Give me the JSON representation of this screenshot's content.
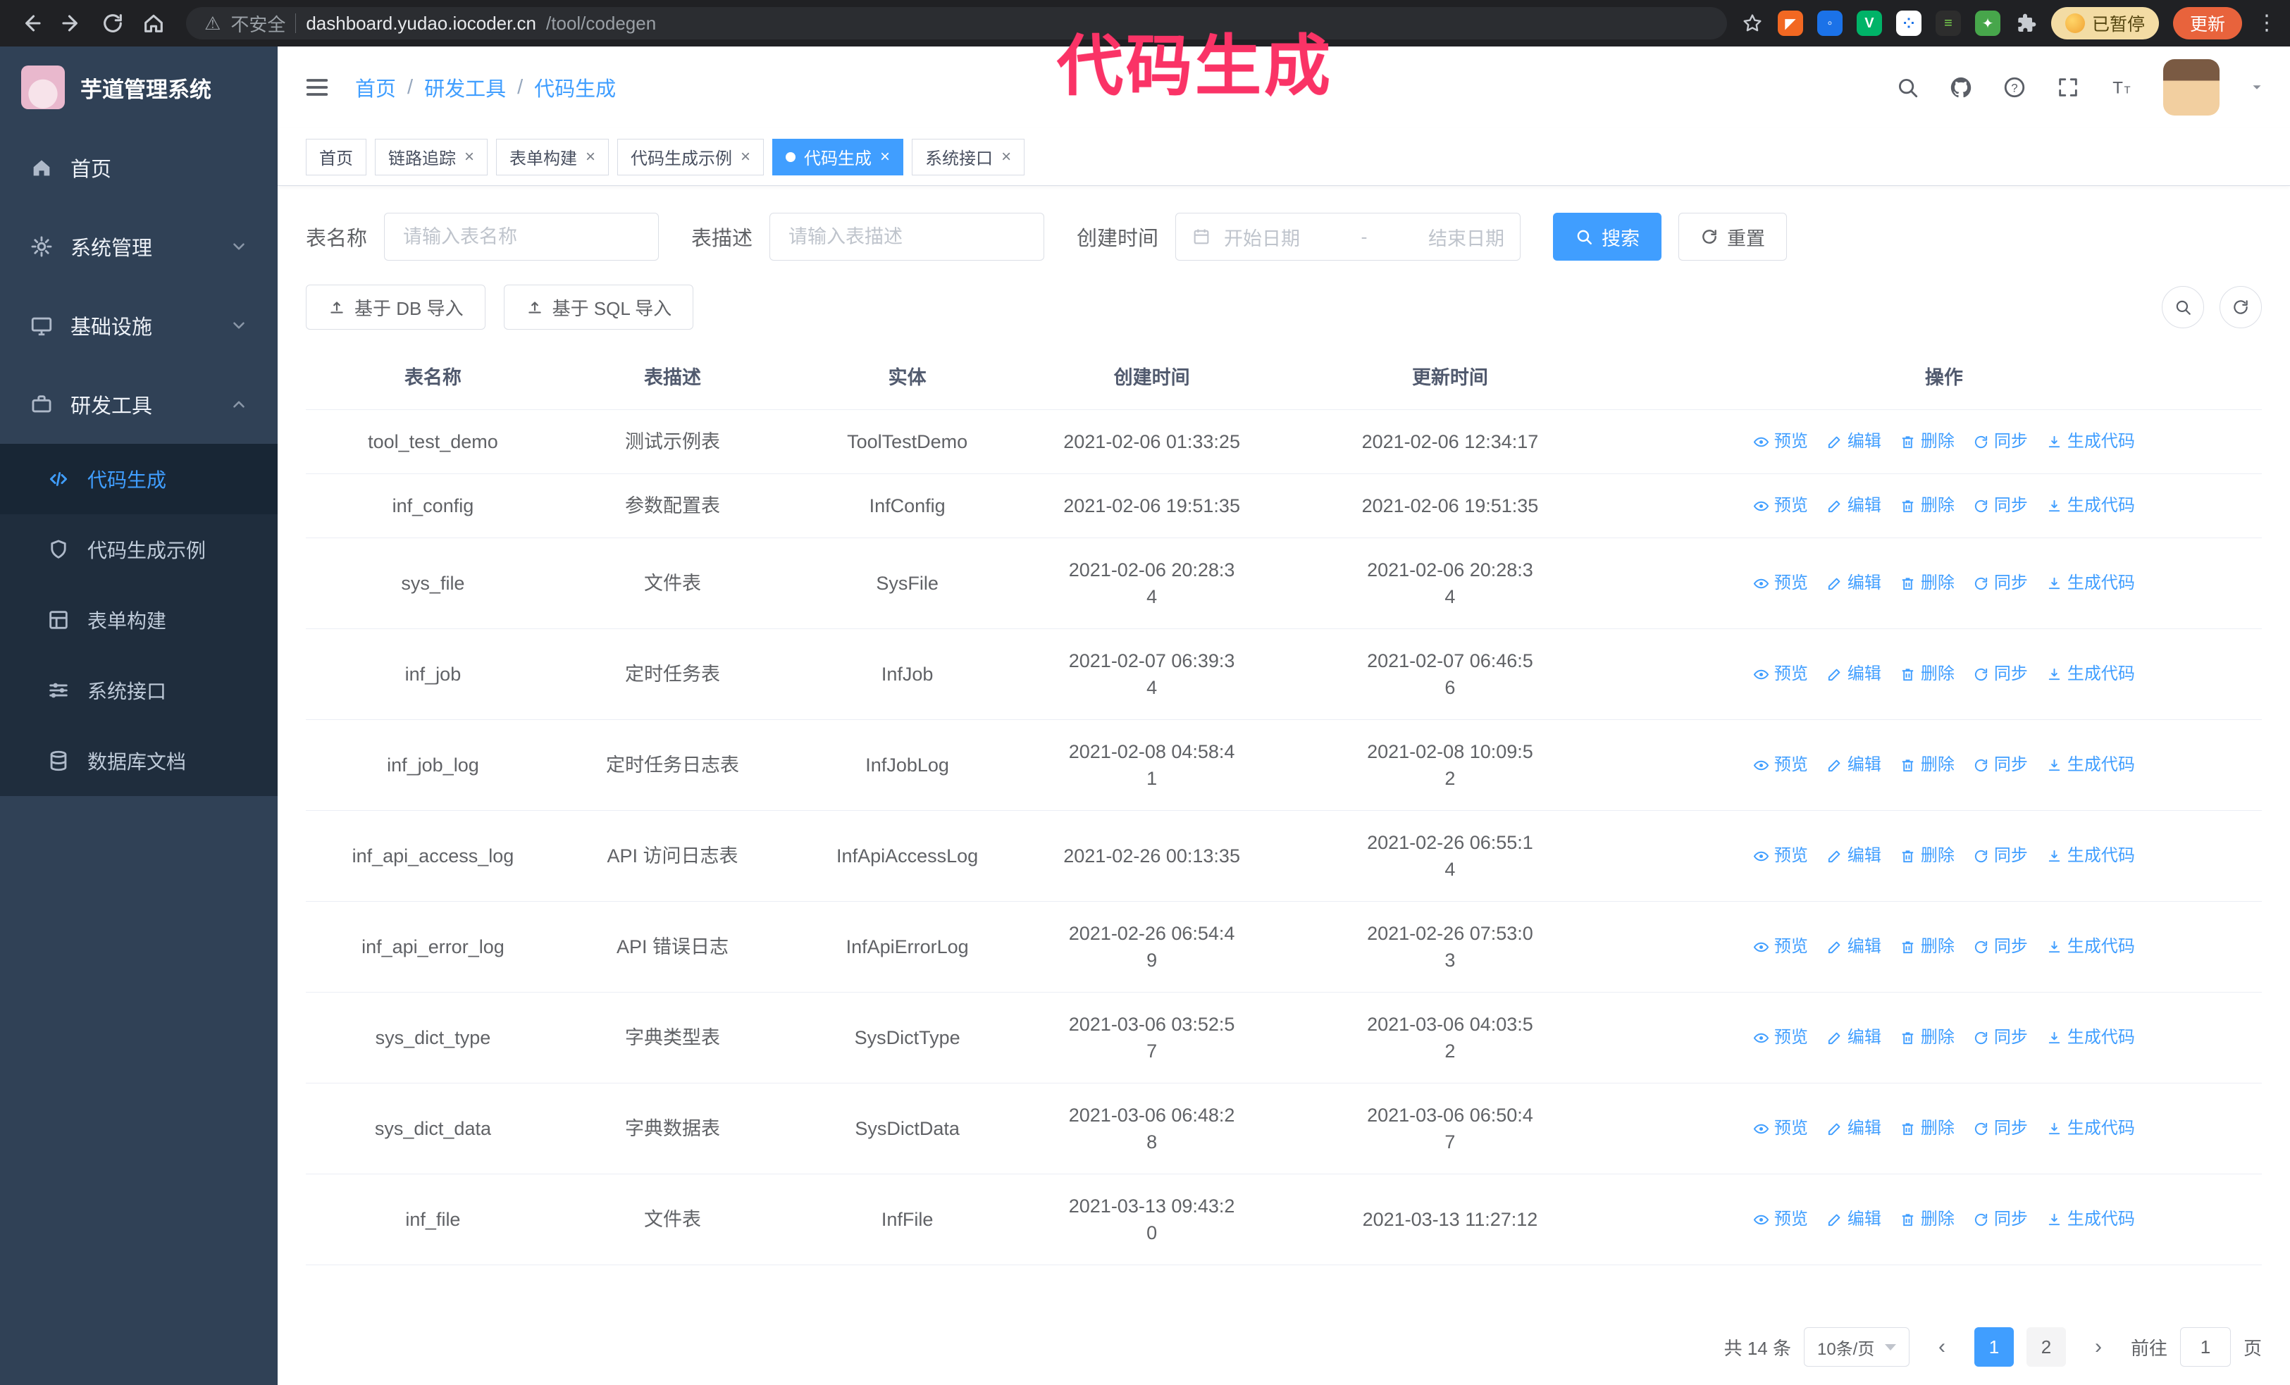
{
  "annotation": {
    "text": "代码生成",
    "color": "#fa3366"
  },
  "browser": {
    "security_label": "不安全",
    "url_host": "dashboard.yudao.iocoder.cn",
    "url_path": "/tool/codegen",
    "paused_badge": "已暂停",
    "update_button": "更新"
  },
  "sidebar": {
    "logo_title": "芋道管理系统",
    "items": [
      {
        "label": "首页",
        "expandable": false
      },
      {
        "label": "系统管理",
        "expandable": true
      },
      {
        "label": "基础设施",
        "expandable": true
      },
      {
        "label": "研发工具",
        "expandable": true,
        "expanded": true
      }
    ],
    "sub_items": [
      {
        "label": "代码生成",
        "active": true
      },
      {
        "label": "代码生成示例",
        "active": false
      },
      {
        "label": "表单构建",
        "active": false
      },
      {
        "label": "系统接口",
        "active": false
      },
      {
        "label": "数据库文档",
        "active": false
      }
    ]
  },
  "header": {
    "breadcrumb": [
      "首页",
      "研发工具",
      "代码生成"
    ]
  },
  "tabs": [
    {
      "label": "首页",
      "closable": false,
      "active": false
    },
    {
      "label": "链路追踪",
      "closable": true,
      "active": false
    },
    {
      "label": "表单构建",
      "closable": true,
      "active": false
    },
    {
      "label": "代码生成示例",
      "closable": true,
      "active": false
    },
    {
      "label": "代码生成",
      "closable": true,
      "active": true
    },
    {
      "label": "系统接口",
      "closable": true,
      "active": false
    }
  ],
  "filters": {
    "table_name_label": "表名称",
    "table_name_placeholder": "请输入表名称",
    "table_desc_label": "表描述",
    "table_desc_placeholder": "请输入表描述",
    "create_time_label": "创建时间",
    "date_start_placeholder": "开始日期",
    "date_separator": "-",
    "date_end_placeholder": "结束日期",
    "search_label": "搜索",
    "reset_label": "重置"
  },
  "toolbar": {
    "import_db_label": "基于 DB 导入",
    "import_sql_label": "基于 SQL 导入"
  },
  "table": {
    "columns": [
      "表名称",
      "表描述",
      "实体",
      "创建时间",
      "更新时间",
      "操作"
    ],
    "op_labels": [
      "预览",
      "编辑",
      "删除",
      "同步",
      "生成代码"
    ],
    "rows": [
      {
        "name": "tool_test_demo",
        "desc": "测试示例表",
        "entity": "ToolTestDemo",
        "created": "2021-02-06 01:33:25",
        "updated": "2021-02-06 12:34:17"
      },
      {
        "name": "inf_config",
        "desc": "参数配置表",
        "entity": "InfConfig",
        "created": "2021-02-06 19:51:35",
        "updated": "2021-02-06 19:51:35"
      },
      {
        "name": "sys_file",
        "desc": "文件表",
        "entity": "SysFile",
        "created": "2021-02-06 20:28:3\n4",
        "updated": "2021-02-06 20:28:3\n4"
      },
      {
        "name": "inf_job",
        "desc": "定时任务表",
        "entity": "InfJob",
        "created": "2021-02-07 06:39:3\n4",
        "updated": "2021-02-07 06:46:5\n6"
      },
      {
        "name": "inf_job_log",
        "desc": "定时任务日志表",
        "entity": "InfJobLog",
        "created": "2021-02-08 04:58:4\n1",
        "updated": "2021-02-08 10:09:5\n2"
      },
      {
        "name": "inf_api_access_log",
        "desc": "API 访问日志表",
        "entity": "InfApiAccessLog",
        "created": "2021-02-26 00:13:35",
        "updated": "2021-02-26 06:55:1\n4"
      },
      {
        "name": "inf_api_error_log",
        "desc": "API 错误日志",
        "entity": "InfApiErrorLog",
        "created": "2021-02-26 06:54:4\n9",
        "updated": "2021-02-26 07:53:0\n3"
      },
      {
        "name": "sys_dict_type",
        "desc": "字典类型表",
        "entity": "SysDictType",
        "created": "2021-03-06 03:52:5\n7",
        "updated": "2021-03-06 04:03:5\n2"
      },
      {
        "name": "sys_dict_data",
        "desc": "字典数据表",
        "entity": "SysDictData",
        "created": "2021-03-06 06:48:2\n8",
        "updated": "2021-03-06 06:50:4\n7"
      },
      {
        "name": "inf_file",
        "desc": "文件表",
        "entity": "InfFile",
        "created": "2021-03-13 09:43:2\n0",
        "updated": "2021-03-13 11:27:12"
      }
    ]
  },
  "pagination": {
    "total": "共 14 条",
    "page_size": "10条/页",
    "pages": [
      "1",
      "2"
    ],
    "current_page": "1",
    "goto_label": "前往",
    "goto_value": "1",
    "goto_suffix": "页"
  }
}
